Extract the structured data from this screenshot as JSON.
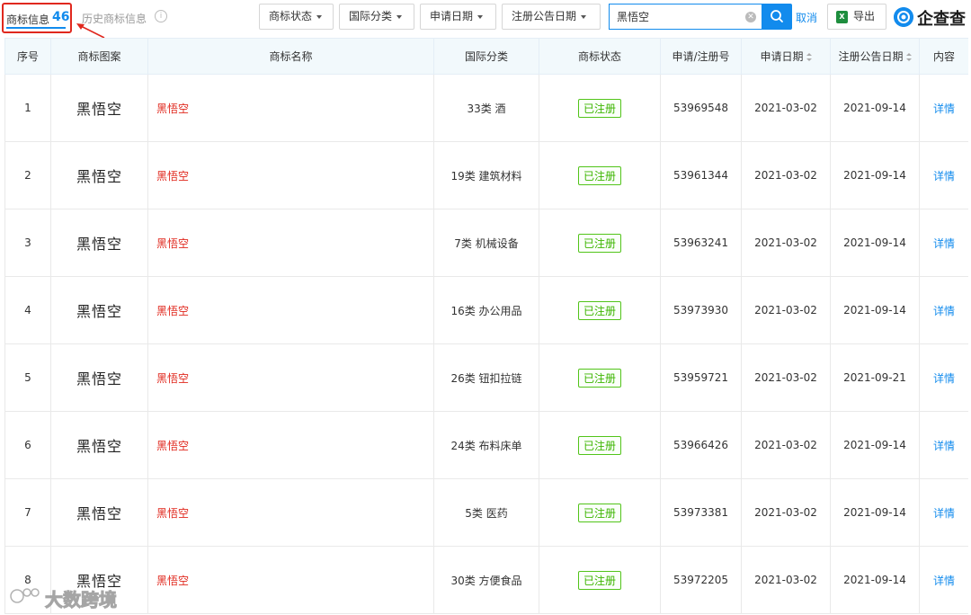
{
  "tabs": {
    "active_label": "商标信息",
    "active_count": "46",
    "history_label": "历史商标信息",
    "info_icon": "info-icon"
  },
  "filters": [
    {
      "label": "商标状态"
    },
    {
      "label": "国际分类"
    },
    {
      "label": "申请日期"
    },
    {
      "label": "注册公告日期"
    }
  ],
  "search": {
    "value": "黑悟空",
    "placeholder": ""
  },
  "cancel_label": "取消",
  "export_label": "导出",
  "brand": {
    "name": "企查查"
  },
  "table": {
    "headers": {
      "index": "序号",
      "pattern": "商标图案",
      "name": "商标名称",
      "class": "国际分类",
      "status": "商标状态",
      "reg_no": "申请/注册号",
      "apply_date": "申请日期",
      "pub_date": "注册公告日期",
      "content": "内容"
    },
    "rows": [
      {
        "index": "1",
        "pattern": "黑悟空",
        "name": "黑悟空",
        "class": "33类 酒",
        "status": "已注册",
        "reg_no": "53969548",
        "apply_date": "2021-03-02",
        "pub_date": "2021-09-14",
        "detail": "详情"
      },
      {
        "index": "2",
        "pattern": "黑悟空",
        "name": "黑悟空",
        "class": "19类 建筑材料",
        "status": "已注册",
        "reg_no": "53961344",
        "apply_date": "2021-03-02",
        "pub_date": "2021-09-14",
        "detail": "详情"
      },
      {
        "index": "3",
        "pattern": "黑悟空",
        "name": "黑悟空",
        "class": "7类 机械设备",
        "status": "已注册",
        "reg_no": "53963241",
        "apply_date": "2021-03-02",
        "pub_date": "2021-09-14",
        "detail": "详情"
      },
      {
        "index": "4",
        "pattern": "黑悟空",
        "name": "黑悟空",
        "class": "16类 办公用品",
        "status": "已注册",
        "reg_no": "53973930",
        "apply_date": "2021-03-02",
        "pub_date": "2021-09-14",
        "detail": "详情"
      },
      {
        "index": "5",
        "pattern": "黑悟空",
        "name": "黑悟空",
        "class": "26类 钮扣拉链",
        "status": "已注册",
        "reg_no": "53959721",
        "apply_date": "2021-03-02",
        "pub_date": "2021-09-21",
        "detail": "详情"
      },
      {
        "index": "6",
        "pattern": "黑悟空",
        "name": "黑悟空",
        "class": "24类 布料床单",
        "status": "已注册",
        "reg_no": "53966426",
        "apply_date": "2021-03-02",
        "pub_date": "2021-09-14",
        "detail": "详情"
      },
      {
        "index": "7",
        "pattern": "黑悟空",
        "name": "黑悟空",
        "class": "5类 医药",
        "status": "已注册",
        "reg_no": "53973381",
        "apply_date": "2021-03-02",
        "pub_date": "2021-09-14",
        "detail": "详情"
      },
      {
        "index": "8",
        "pattern": "黑悟空",
        "name": "黑悟空",
        "class": "30类 方便食品",
        "status": "已注册",
        "reg_no": "53972205",
        "apply_date": "2021-03-02",
        "pub_date": "2021-09-14",
        "detail": "详情"
      }
    ]
  },
  "watermark": {
    "text": "大数跨境"
  },
  "colors": {
    "accent": "#128bed",
    "highlight": "#e0281e",
    "status_green": "#3cb500",
    "header_bg": "#f2f9fc"
  }
}
